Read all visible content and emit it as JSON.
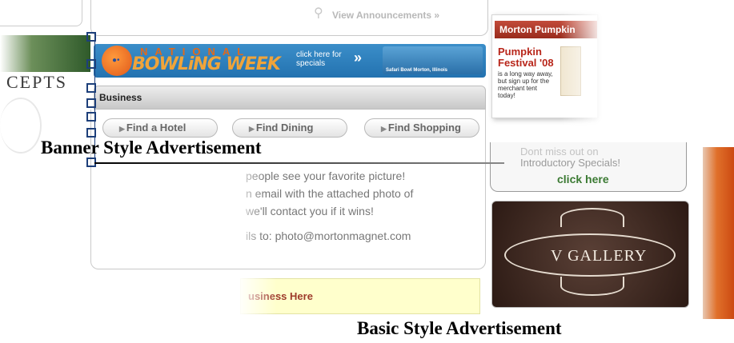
{
  "left_panel": {
    "concepts_text": "CEPTS"
  },
  "announcements": {
    "link_text": "View Announcements »"
  },
  "banner": {
    "national": "NATIONAL",
    "bowling_week": "BOWLiNG WEEK",
    "click_here": "click here for specials",
    "arrows": "»",
    "safari_caption": "Safari Bowl Morton, Illinois"
  },
  "business": {
    "section_title": "Business",
    "buttons": [
      "Find a Hotel",
      "Find Dining",
      "Find Shopping"
    ],
    "photo_text": [
      "people see your favorite picture!",
      "n email with the attached photo of",
      "we'll contact you if it wins!",
      "ils to: photo@mortonmagnet.com"
    ],
    "yellow_text": "usiness Here"
  },
  "right_column": {
    "morton_header": "Morton Pumpkin",
    "pumpkin_title": "Pumpkin Festival '08",
    "pumpkin_body": "is a long way away, but sign up for the merchant tent today!",
    "specials_line1": "Dont miss out on",
    "specials_line2": "Introductory Specials!",
    "specials_click": "click here",
    "gallery_text": "V GALLERY"
  },
  "callouts": {
    "banner_label": "Banner Style Advertisement",
    "basic_label": "Basic Style Advertisement"
  },
  "colors": {
    "banner_blue": "#2f82bf",
    "morton_red": "#b03a2a",
    "click_green": "#3b7a33",
    "handle_blue": "#1d3f7a"
  },
  "icons": {
    "announce": "search-icon",
    "button_arrow": "triangle-right-icon"
  }
}
